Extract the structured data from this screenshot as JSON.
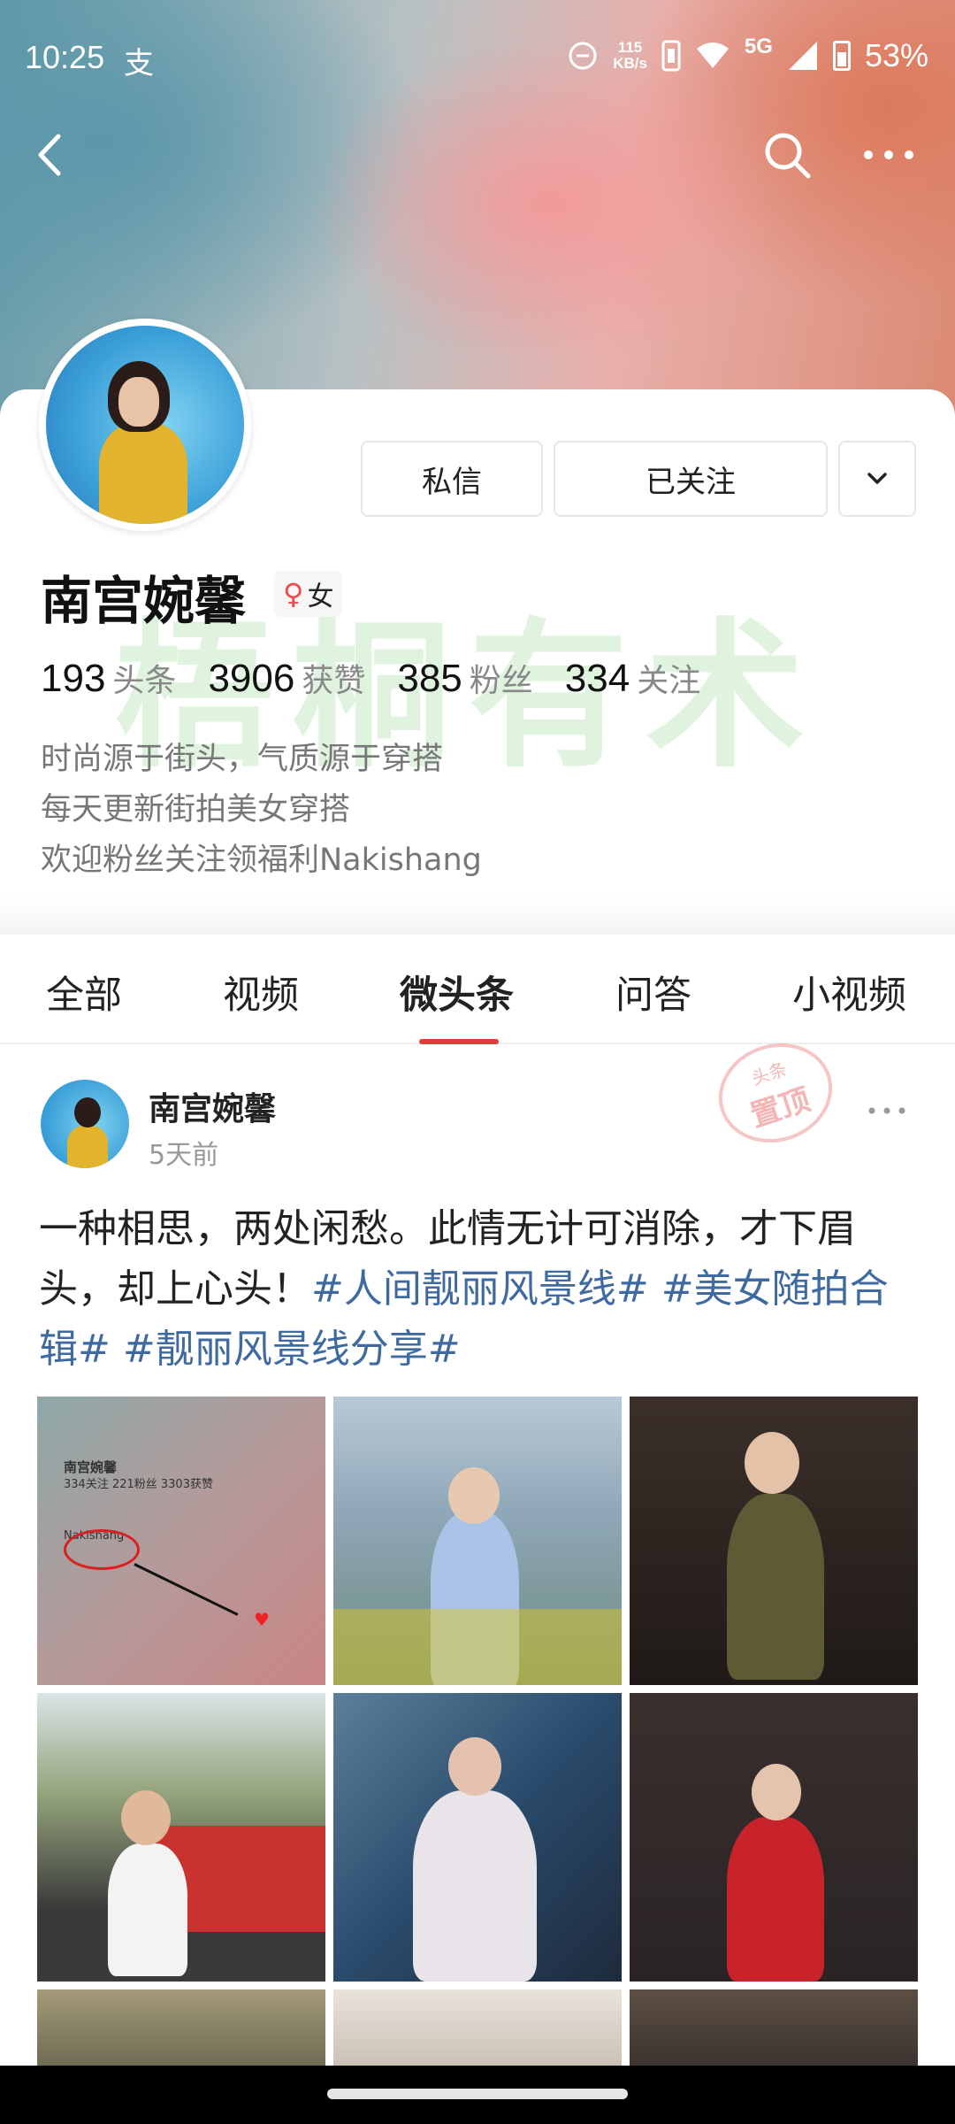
{
  "status_bar": {
    "time": "10:25",
    "extra_icon_glyph": "支",
    "net_speed_top": "115",
    "net_speed_bottom": "KB/s",
    "network": "5G",
    "battery": "53%"
  },
  "nav": {
    "back_icon": "back-icon",
    "search_icon": "search-icon",
    "more_icon": "more-icon"
  },
  "profile": {
    "name": "南宫婉馨",
    "gender_symbol": "♀",
    "gender_label": "女",
    "buttons": {
      "message": "私信",
      "follow": "已关注"
    },
    "stats": [
      {
        "num": "193",
        "label": "头条"
      },
      {
        "num": "3906",
        "label": "获赞"
      },
      {
        "num": "385",
        "label": "粉丝"
      },
      {
        "num": "334",
        "label": "关注"
      }
    ],
    "bio": [
      "时尚源于街头，气质源于穿搭",
      "每天更新街拍美女穿搭",
      "欢迎粉丝关注领福利Nakishang"
    ]
  },
  "watermark": "梧桐有术",
  "tabs": [
    {
      "label": "全部",
      "active": false
    },
    {
      "label": "视频",
      "active": false
    },
    {
      "label": "微头条",
      "active": true
    },
    {
      "label": "问答",
      "active": false
    },
    {
      "label": "小视频",
      "active": false
    }
  ],
  "post": {
    "author": "南宫婉馨",
    "time": "5天前",
    "pin_stamp_top": "头条",
    "pin_stamp_main": "置顶",
    "text_plain": "一种相思，两处闲愁。此情无计可消除，才下眉头，却上心头！",
    "hashtags": [
      "#人间靓丽风景线#",
      "#美女随拍合辑#",
      "#靓丽风景线分享#"
    ],
    "thumb1": {
      "name": "南宫婉馨",
      "stats": "334关注  221粉丝  3303获赞",
      "note": "Nakishang"
    }
  },
  "colors": {
    "accent_red": "#e33c3c",
    "hashtag_blue": "#3f6aa0",
    "watermark_green": "#6ec86e"
  }
}
